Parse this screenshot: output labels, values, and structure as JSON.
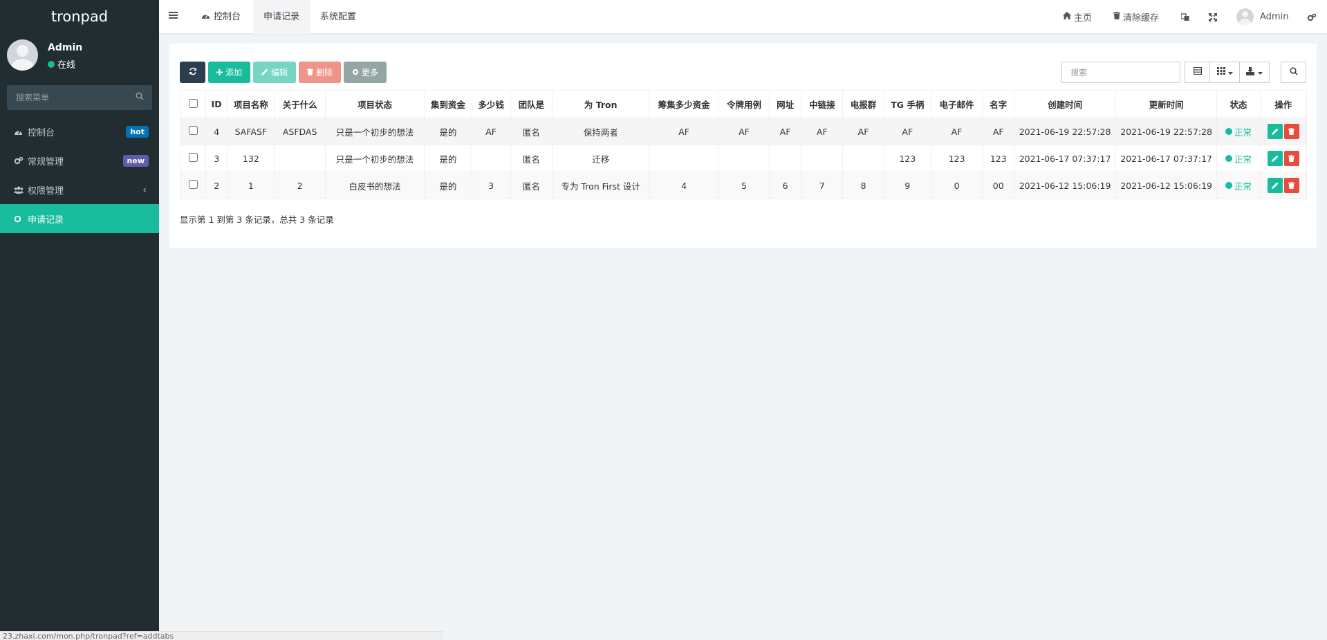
{
  "app": {
    "brand": "tronpad"
  },
  "user": {
    "name": "Admin",
    "status": "在线"
  },
  "sidebar": {
    "search_placeholder": "搜索菜单",
    "items": [
      {
        "label": "控制台",
        "badge": "hot",
        "badge_color": "#0073b7",
        "icon": "dashboard-icon"
      },
      {
        "label": "常规管理",
        "badge": "new",
        "badge_color": "#605ca8",
        "icon": "cogs-icon"
      },
      {
        "label": "权限管理",
        "icon": "group-icon",
        "chevron": "‹"
      },
      {
        "label": "申请记录",
        "icon": "circle-icon",
        "active": true
      }
    ]
  },
  "topbar": {
    "tabs": [
      {
        "label": "控制台",
        "icon": "dashboard-icon"
      },
      {
        "label": "申请记录",
        "active": true
      },
      {
        "label": "系统配置"
      }
    ],
    "home_label": "主页",
    "clear_cache_label": "清除缓存",
    "user_label": "Admin"
  },
  "toolbar": {
    "add_label": "添加",
    "edit_label": "编辑",
    "delete_label": "删除",
    "more_label": "更多",
    "search_placeholder": "搜索"
  },
  "table": {
    "columns": [
      "ID",
      "项目名称",
      "关于什么",
      "项目状态",
      "集到资金",
      "多少钱",
      "团队是",
      "为 Tron",
      "筹集多少资金",
      "令牌用例",
      "网址",
      "中链接",
      "电报群",
      "TG 手柄",
      "电子邮件",
      "名字",
      "创建时间",
      "更新时间",
      "状态",
      "操作"
    ],
    "rows": [
      [
        "4",
        "SAFASF",
        "ASFDAS",
        "只是一个初步的想法",
        "是的",
        "AF",
        "匿名",
        "保持两者",
        "AF",
        "AF",
        "AF",
        "AF",
        "AF",
        "AF",
        "AF",
        "AF",
        "2021-06-19 22:57:28",
        "2021-06-19 22:57:28",
        "正常"
      ],
      [
        "3",
        "132",
        "",
        "只是一个初步的想法",
        "是的",
        "",
        "匿名",
        "迁移",
        "",
        "",
        "",
        "",
        "",
        "123",
        "123",
        "123",
        "2021-06-17 07:37:17",
        "2021-06-17 07:37:17",
        "正常"
      ],
      [
        "2",
        "1",
        "2",
        "白皮书的想法",
        "是的",
        "3",
        "匿名",
        "专为 Tron First 设计",
        "4",
        "5",
        "6",
        "7",
        "8",
        "9",
        "0",
        "00",
        "2021-06-12 15:06:19",
        "2021-06-12 15:06:19",
        "正常"
      ]
    ],
    "pagination_info": "显示第 1 到第 3 条记录，总共 3 条记录"
  },
  "statusbar": {
    "url": "23.zhaxi.com/mon.php/tronpad?ref=addtabs"
  },
  "colors": {
    "sidebar_bg": "#222d32",
    "accent": "#18bc9c",
    "danger": "#e74c3c",
    "dark": "#2c3e50"
  }
}
